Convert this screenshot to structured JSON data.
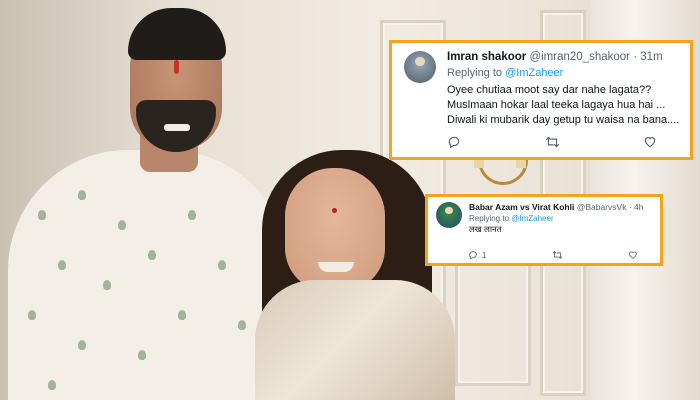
{
  "tweets": [
    {
      "display_name": "Imran shakoor",
      "handle": "@imran20_shakoor",
      "separator": "·",
      "time": "31m",
      "replying_prefix": "Replying to ",
      "replying_to": "@ImZaheer",
      "lines": [
        "Oyee chutiaa moot say dar nahe lagata??",
        "Muslmaan hokar laal teeka lagaya hua hai ...",
        "Diwali ki mubarik day getup tu waisa na bana...."
      ],
      "actions": {
        "reply_icon": "comment-icon",
        "retweet_icon": "retweet-icon",
        "like_icon": "heart-icon"
      }
    },
    {
      "display_name": "Babar Azam vs Virat Kohli",
      "handle": "@BabarvsVk",
      "separator": "·",
      "time": "4h",
      "replying_prefix": "Replying to ",
      "replying_to": "@ImZaheer",
      "lines": [
        "लख लानत"
      ],
      "reply_count": "1",
      "actions": {
        "reply_icon": "comment-icon",
        "retweet_icon": "retweet-icon",
        "like_icon": "heart-icon"
      }
    }
  ],
  "colors": {
    "highlight_border": "#f7a21b",
    "link": "#1d9bf0",
    "muted": "#536471"
  }
}
